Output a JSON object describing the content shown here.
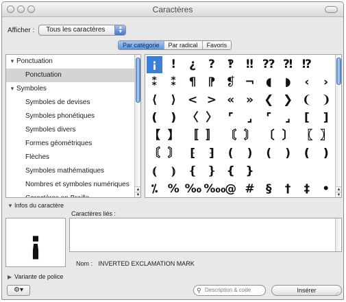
{
  "window": {
    "title": "Caractères"
  },
  "toolbar": {
    "show_label": "Afficher :",
    "show_value": "Tous les caractères"
  },
  "tabs": [
    {
      "label": "Par catégorie",
      "active": true
    },
    {
      "label": "Par radical",
      "active": false
    },
    {
      "label": "Favoris",
      "active": false
    }
  ],
  "categories": [
    {
      "label": "Ponctuation",
      "type": "group",
      "expanded": true,
      "selected": false
    },
    {
      "label": "Ponctuation",
      "type": "sub",
      "selected": true
    },
    {
      "label": "Symboles",
      "type": "group",
      "expanded": true,
      "selected": false
    },
    {
      "label": "Symboles de devises",
      "type": "sub",
      "selected": false
    },
    {
      "label": "Symboles phonétiques",
      "type": "sub",
      "selected": false
    },
    {
      "label": "Symboles divers",
      "type": "sub",
      "selected": false
    },
    {
      "label": "Formes géométriques",
      "type": "sub",
      "selected": false
    },
    {
      "label": "Flèches",
      "type": "sub",
      "selected": false
    },
    {
      "label": "Symboles mathématiques",
      "type": "sub",
      "selected": false
    },
    {
      "label": "Nombres et symboles numériques",
      "type": "sub",
      "selected": false
    },
    {
      "label": "Caractères en Braille",
      "type": "sub",
      "selected": false
    }
  ],
  "characters": [
    [
      "¡",
      "!",
      "¿",
      "?",
      "‽",
      "‼",
      "⁇",
      "⁈",
      "⁉",
      ""
    ],
    [
      "⁑",
      "⁑",
      "¶",
      "⁋",
      "❡",
      "¬",
      "◖",
      "◗",
      "‹",
      "›"
    ],
    [
      "⟨",
      "⟩",
      "<",
      ">",
      "«",
      "»",
      "❮",
      "❯",
      "❨",
      "❩"
    ],
    [
      "❪",
      "❫",
      "〈",
      "〉",
      "⌜",
      "⌟",
      "⌜",
      "⌟",
      "[",
      "]"
    ],
    [
      "【",
      "】",
      "〚",
      "〛",
      "〘",
      "〙",
      "〔",
      "〕",
      "〖",
      "〗"
    ],
    [
      "〘",
      "〙",
      "⁅",
      "⁆",
      "(",
      ")",
      "(",
      ")",
      "❪",
      "❫"
    ],
    [
      "⦅",
      "⦆",
      "❴",
      "❵",
      "{",
      "}",
      "",
      "",
      "",
      ""
    ],
    [
      "⁒",
      "%",
      "‰",
      "‱",
      "@",
      "#",
      "§",
      "†",
      "‡",
      "•"
    ]
  ],
  "selected_char_index": [
    0,
    0
  ],
  "info": {
    "header": "Infos du caractère",
    "related_label": "Caractères liés :",
    "preview_char": "¡",
    "name_label": "Nom :",
    "name_value": "INVERTED EXCLAMATION MARK"
  },
  "variant_label": "Variante de police",
  "bottom": {
    "gear_label": "⚙▾",
    "search_placeholder": "Description & code",
    "insert_label": "Insérer"
  }
}
